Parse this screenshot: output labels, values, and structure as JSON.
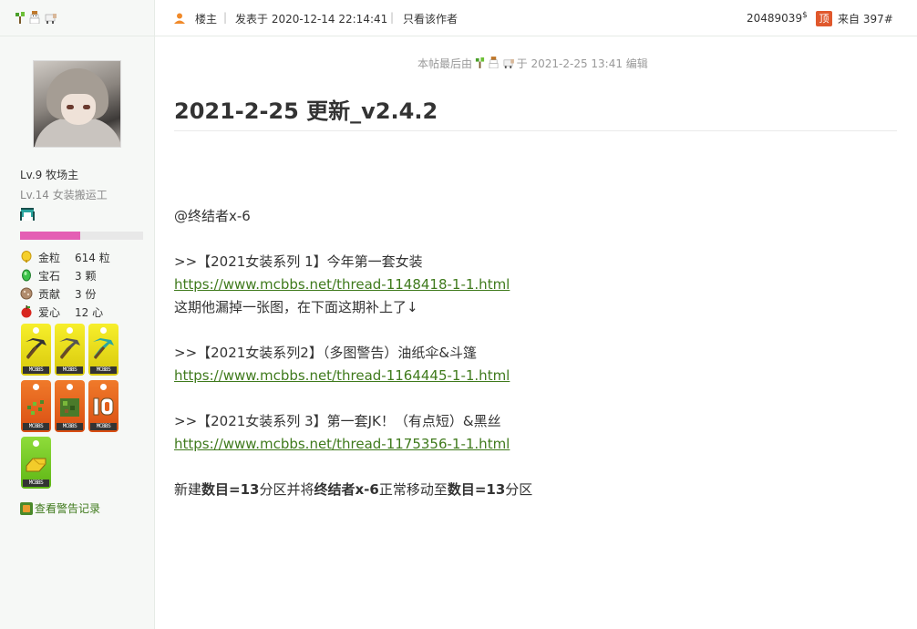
{
  "user": {
    "name_icons": [
      "sapling-icon",
      "snowman-icon",
      "sheep-icon"
    ],
    "level_main": "Lv.9 牧场主",
    "level_sub": "Lv.14 女装搬运工",
    "stats": [
      {
        "icon": "gold-nugget-icon",
        "label": "金粒",
        "value": "614 粒"
      },
      {
        "icon": "emerald-icon",
        "label": "宝石",
        "value": "3 颗"
      },
      {
        "icon": "contribution-icon",
        "label": "贡献",
        "value": "3 份"
      },
      {
        "icon": "apple-icon",
        "label": "爱心",
        "value": "12 心"
      }
    ],
    "medal_tag": "MCBBS",
    "warning_link": "查看警告记录"
  },
  "post": {
    "author_label": "楼主",
    "posted_at": "发表于 2020-12-14 22:14:41",
    "only_author": "只看该作者",
    "number": "20489039",
    "number_sup": "$",
    "top_badge": "顶",
    "floor": "来自 397#",
    "edit_prefix": "本帖最后由",
    "edit_suffix": "于 2021-2-25 13:41 编辑",
    "title": "2021-2-25 更新_v2.4.2",
    "lines": {
      "mention": "@终结者x-6",
      "s1_title": ">>【2021女装系列 1】今年第一套女装",
      "s1_link": "https://www.mcbbs.net/thread-1148418-1-1.html",
      "s1_note": "这期他漏掉一张图，在下面这期补上了↓",
      "s2_title": ">>【2021女装系列2】（多图警告）油纸伞&斗篷",
      "s2_link": "https://www.mcbbs.net/thread-1164445-1-1.html",
      "s3_title": ">>【2021女装系列 3】第一套JK！（有点短）&黑丝",
      "s3_link": "https://www.mcbbs.net/thread-1175356-1-1.html",
      "final_1": "新建",
      "final_2": "数目=13",
      "final_3": "分区并将",
      "final_4": "终结者x-6",
      "final_5": "正常移动至",
      "final_6": "数目=13",
      "final_7": "分区"
    }
  },
  "colors": {
    "link": "#3f7a1c",
    "progress": "#e45fb4",
    "top_badge": "#e0582c"
  },
  "progress_fraction": 0.49
}
